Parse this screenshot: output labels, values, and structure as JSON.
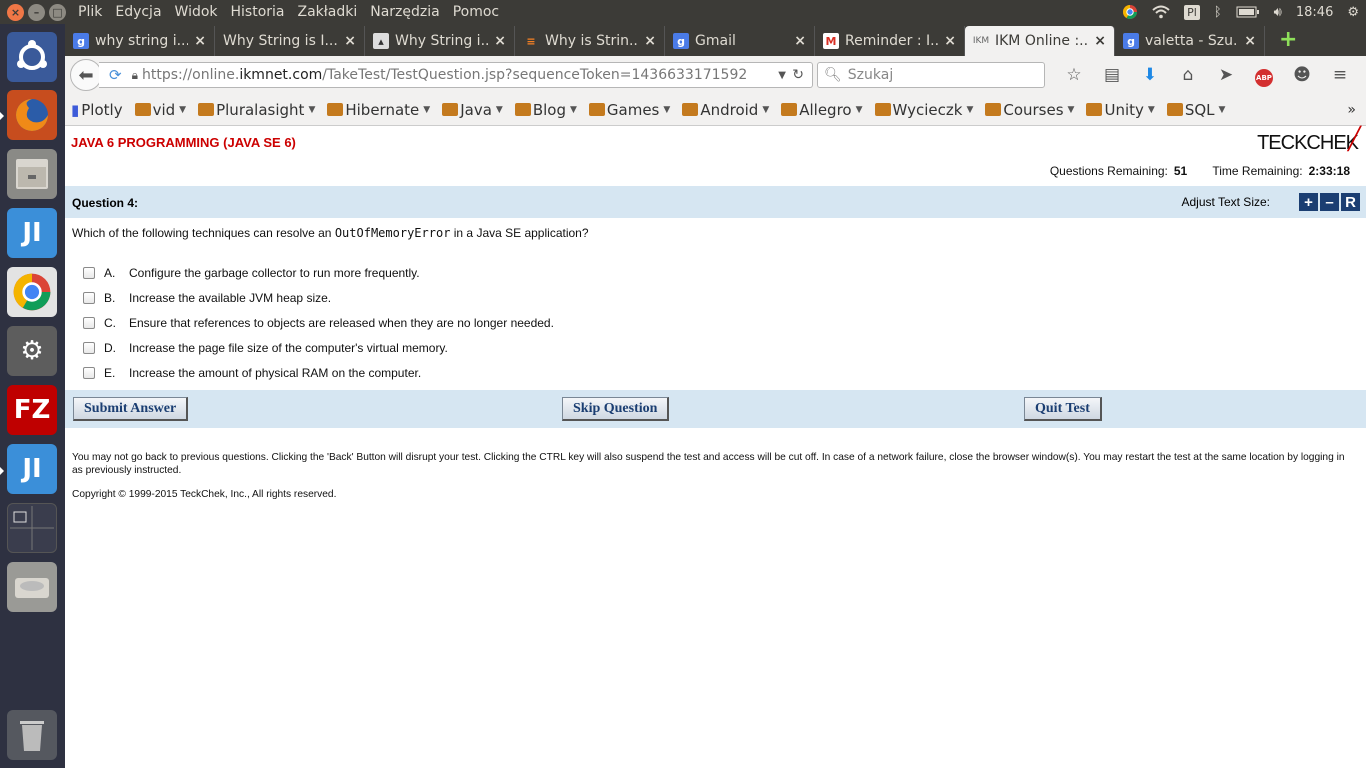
{
  "topbar": {
    "menus": [
      "Plik",
      "Edycja",
      "Widok",
      "Historia",
      "Zakładki",
      "Narzędzia",
      "Pomoc"
    ],
    "keyboard": "Pl",
    "time": "18:46"
  },
  "tabs": [
    {
      "label": "why string i...",
      "icon": "google-icon",
      "color": "#4a7be7"
    },
    {
      "label": "Why String is I...",
      "icon": "none",
      "color": ""
    },
    {
      "label": "Why String i...",
      "icon": "image-icon",
      "color": "#ddd"
    },
    {
      "label": "Why is Strin...",
      "icon": "stackoverflow-icon",
      "color": "#f48024"
    },
    {
      "label": "Gmail",
      "icon": "google-icon",
      "color": "#4a7be7"
    },
    {
      "label": "Reminder : I...",
      "icon": "gmail-icon",
      "color": "#d93025"
    },
    {
      "label": "IKM Online :...",
      "icon": "ikm-icon",
      "color": ""
    },
    {
      "label": "valetta - Szu...",
      "icon": "google-icon",
      "color": "#4a7be7"
    }
  ],
  "nav": {
    "url_prefix": "https://online.",
    "url_domain": "ikmnet.com",
    "url_path": "/TakeTest/TestQuestion.jsp?sequenceToken=1436633171592",
    "search_placeholder": "Szukaj"
  },
  "bookmarks": [
    "Plotly",
    "vid",
    "Pluralasight",
    "Hibernate",
    "Java",
    "Blog",
    "Games",
    "Android",
    "Allegro",
    "Wycieczk",
    "Courses",
    "Unity",
    "SQL"
  ],
  "page": {
    "course_title": "JAVA 6 PROGRAMMING (JAVA SE 6)",
    "logo": "TECKCHEK",
    "questions_remaining_label": "Questions Remaining:",
    "questions_remaining": "51",
    "time_remaining_label": "Time Remaining:",
    "time_remaining": "2:33:18",
    "question_label": "Question 4:",
    "adjust_label": "Adjust Text Size:",
    "adjust_buttons": [
      "+",
      "–",
      "R"
    ],
    "question_prefix": "Which of the following techniques can resolve an ",
    "question_code": "OutOfMemoryError",
    "question_suffix": " in a Java SE application?",
    "options": [
      {
        "letter": "A.",
        "text": "Configure the garbage collector to run more frequently."
      },
      {
        "letter": "B.",
        "text": "Increase the available JVM heap size."
      },
      {
        "letter": "C.",
        "text": "Ensure that references to objects are released when they are no longer needed."
      },
      {
        "letter": "D.",
        "text": "Increase the page file size of the computer's virtual memory."
      },
      {
        "letter": "E.",
        "text": "Increase the amount of physical RAM on the computer."
      }
    ],
    "submit_label": "Submit Answer",
    "skip_label": "Skip Question",
    "quit_label": "Quit Test",
    "disclaimer": "You may not go back to previous questions. Clicking the 'Back' Button will disrupt your test. Clicking the CTRL key will also suspend the test and access will be cut off. In case of a network failure, close the browser window(s). You may restart the test at the same location by logging in as previously instructed.",
    "copyright": "Copyright © 1999-2015 TeckChek, Inc., All rights reserved."
  },
  "colors": {
    "accent_blue": "#1b3e72",
    "header_band": "#d6e6f2",
    "title_red": "#cc0000"
  }
}
